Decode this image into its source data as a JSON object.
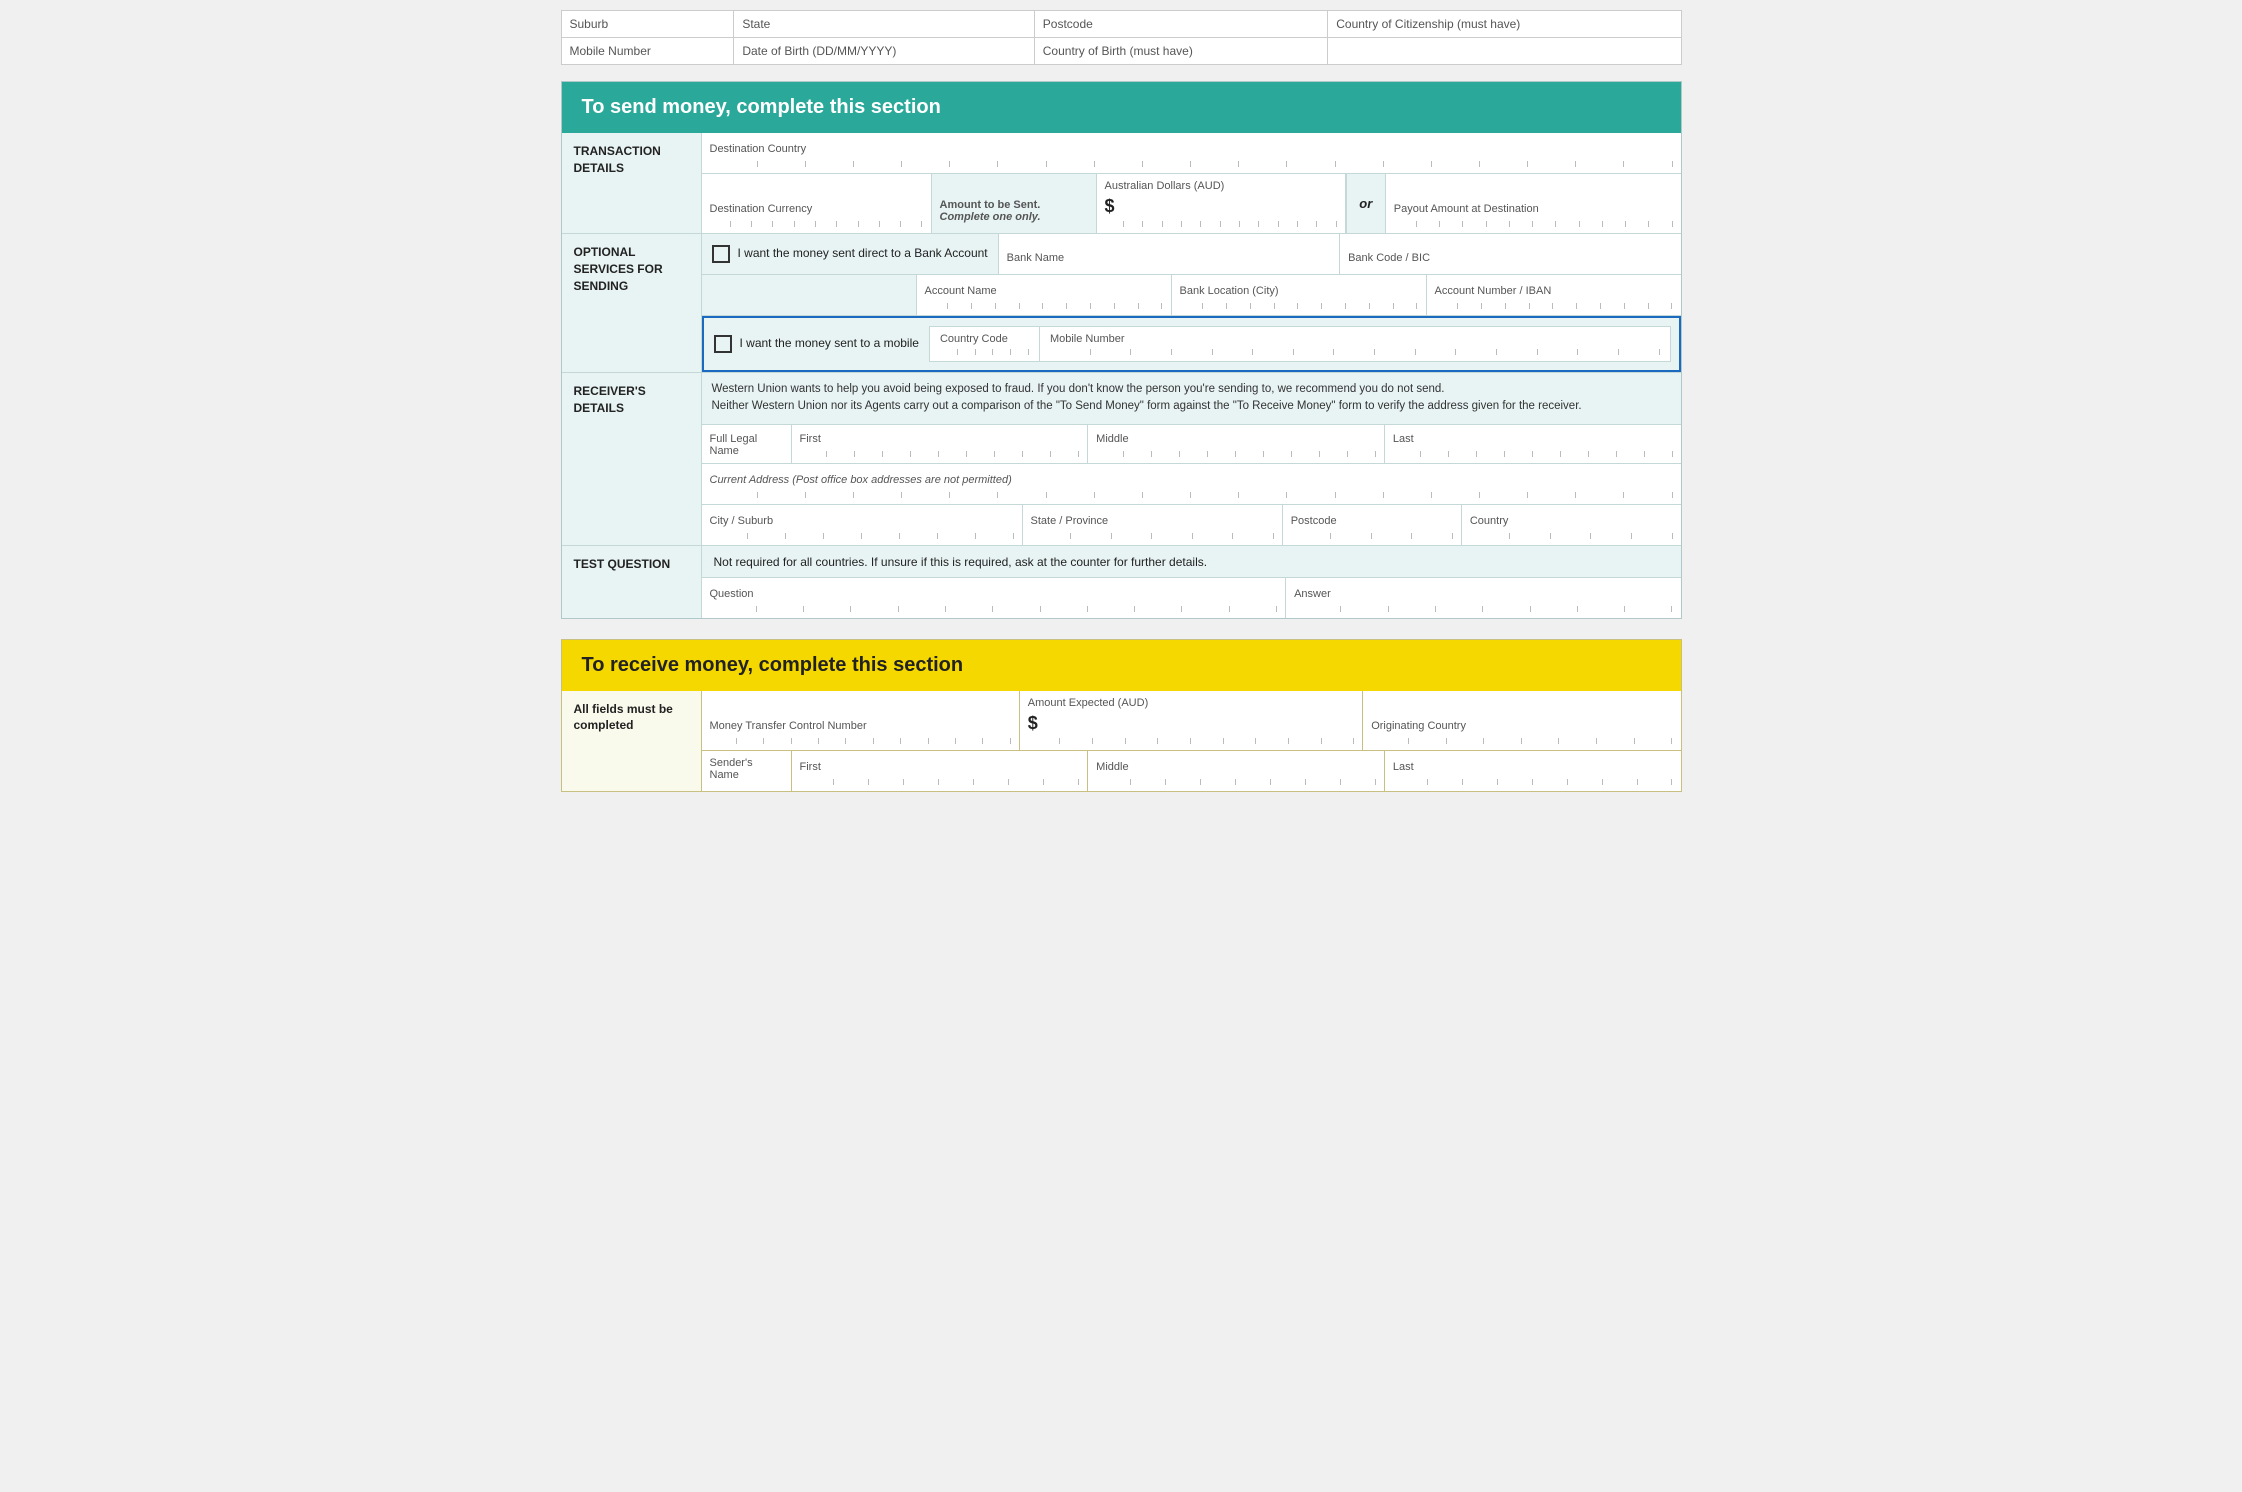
{
  "top_table": {
    "row1": [
      "Suburb",
      "State",
      "Postcode",
      "Country of Citizenship (must have)"
    ],
    "row2_labels": [
      "Mobile Number",
      "Date of Birth (DD/MM/YYYY)",
      "Country of Birth (must have)"
    ]
  },
  "send_section": {
    "header": "To send money, complete this section",
    "transaction_label": "TRANSACTION DETAILS",
    "destination_country_label": "Destination Country",
    "destination_currency_label": "Destination Currency",
    "amount_to_be_sent_label": "Amount to be Sent.",
    "amount_complete_label": "Complete one only.",
    "aud_label": "Australian Dollars (AUD)",
    "dollar_sign": "$",
    "or_label": "or",
    "payout_amount_label": "Payout Amount at Destination",
    "optional_label": "OPTIONAL SERVICES FOR SENDING",
    "bank_checkbox_label": "I want the money sent direct to a Bank Account",
    "bank_name_label": "Bank Name",
    "bank_code_label": "Bank Code / BIC",
    "account_name_label": "Account Name",
    "bank_location_label": "Bank Location (City)",
    "account_number_label": "Account Number / IBAN",
    "mobile_checkbox_label": "I want the money sent to a mobile",
    "country_code_label": "Country Code",
    "mobile_number_label": "Mobile Number",
    "receivers_label": "RECEIVER'S DETAILS",
    "fraud_text_line1": "Western Union wants to help you avoid being exposed to fraud. If you don't know the person you're sending to, we recommend you do not send.",
    "fraud_text_line2": "Neither Western Union nor its Agents carry out a comparison of the \"To Send Money\" form against the \"To Receive Money\" form to verify the address given for the receiver.",
    "full_legal_name_label": "Full Legal Name",
    "first_label": "First",
    "middle_label": "Middle",
    "last_label": "Last",
    "current_address_label": "Current Address  (Post office box addresses are not permitted)",
    "city_suburb_label": "City / Suburb",
    "state_province_label": "State / Province",
    "postcode_label": "Postcode",
    "country_label": "Country",
    "test_question_label": "TEST QUESTION",
    "test_question_note": "Not required for all countries. If unsure if this is required, ask at the counter for further details.",
    "question_label": "Question",
    "answer_label": "Answer"
  },
  "receive_section": {
    "header": "To receive money, complete this section",
    "all_fields_label": "All fields must be completed",
    "money_transfer_label": "Money Transfer Control Number",
    "amount_expected_label": "Amount Expected (AUD)",
    "dollar_sign": "$",
    "originating_country_label": "Originating Country",
    "senders_name_label": "Sender's Name",
    "first_label": "First",
    "middle_label": "Middle",
    "last_label": "Last"
  },
  "colors": {
    "send_header_bg": "#2aa89a",
    "receive_header_bg": "#f5d800",
    "section_bg": "#e8f3f3",
    "border_color": "#c5d8d8",
    "highlight_blue": "#1a6abf"
  }
}
